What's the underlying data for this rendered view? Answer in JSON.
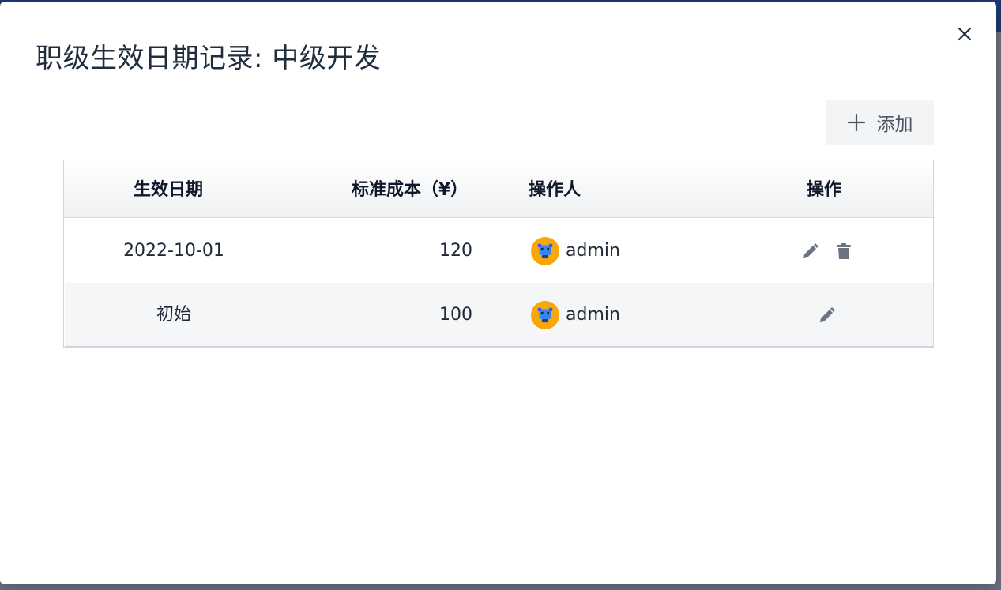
{
  "modal": {
    "title": "职级生效日期记录: 中级开发",
    "add_label": "添加"
  },
  "table": {
    "headers": {
      "date": "生效日期",
      "cost": "标准成本（¥）",
      "operator": "操作人",
      "actions": "操作"
    },
    "rows": [
      {
        "date": "2022-10-01",
        "cost": "120",
        "operator": "admin",
        "actions": [
          "edit-icon",
          "trash-icon"
        ]
      },
      {
        "date": "初始",
        "cost": "100",
        "operator": "admin",
        "actions": [
          "edit-icon"
        ]
      }
    ]
  },
  "colors": {
    "avatar_bg": "#f7a70a",
    "icon_gray": "#6b7280",
    "title_text": "#1f2d3d"
  }
}
